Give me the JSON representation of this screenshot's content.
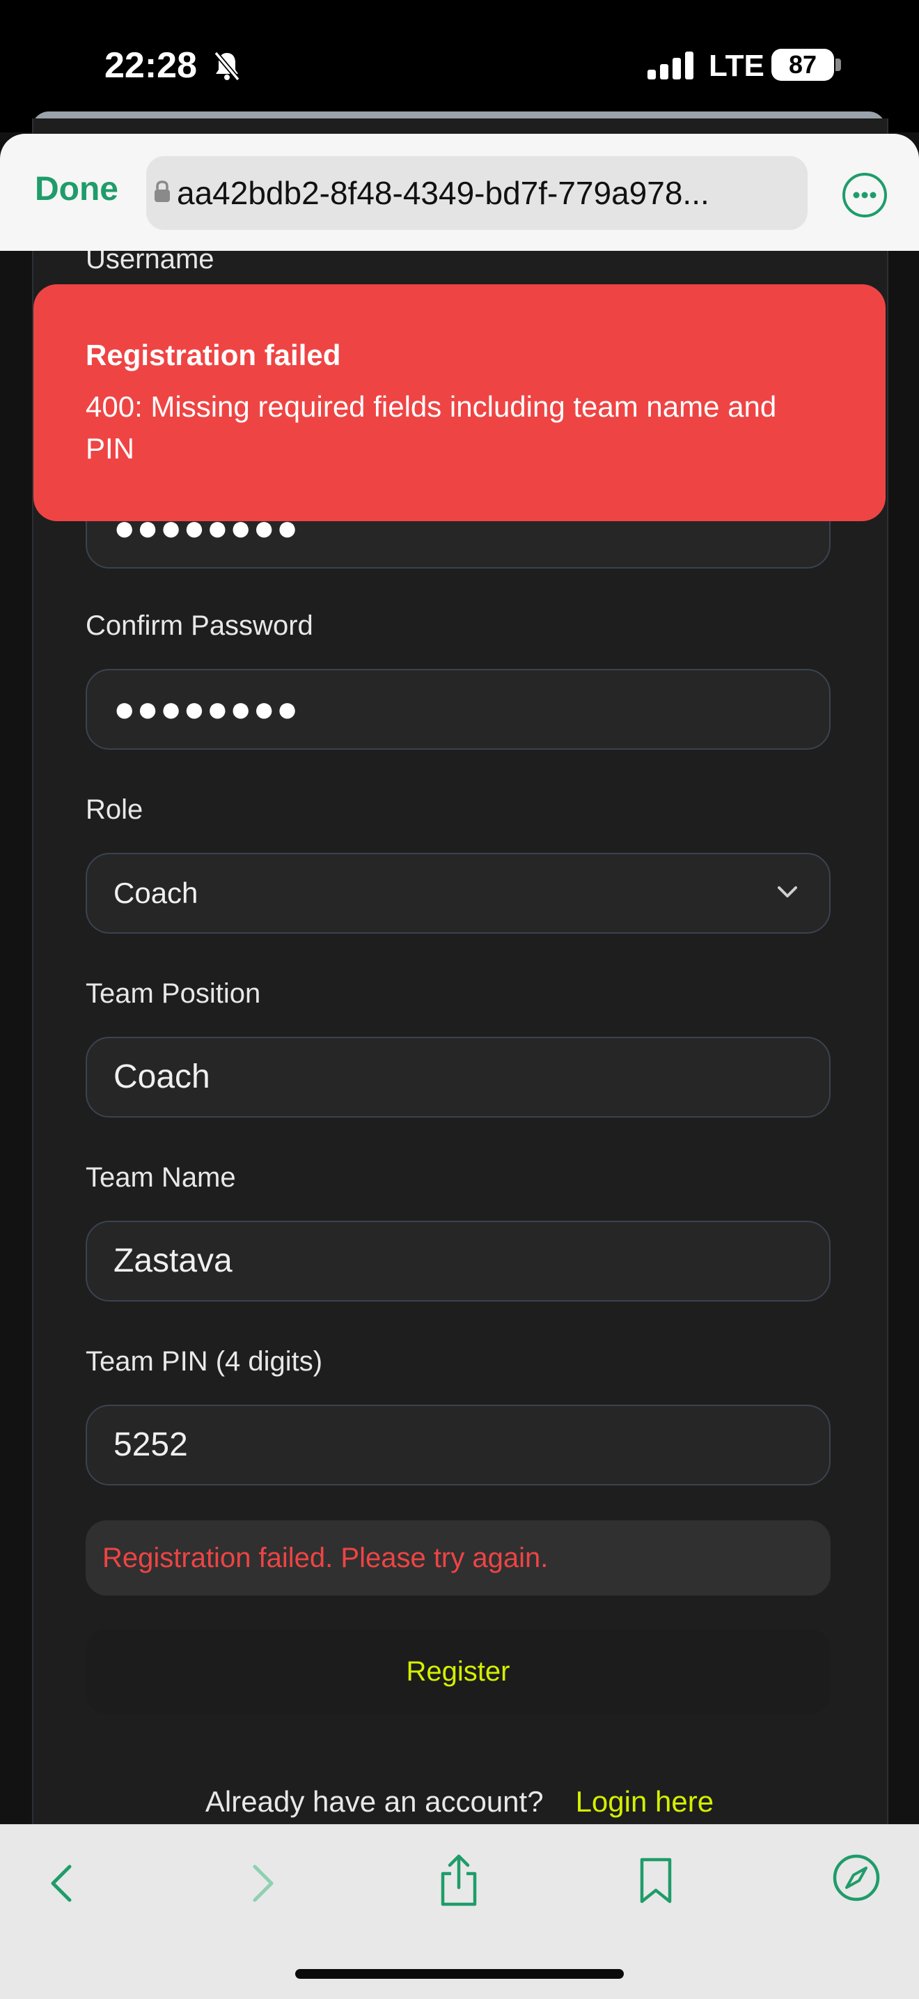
{
  "status_bar": {
    "time": "22:28",
    "network": "LTE",
    "battery": "87"
  },
  "browser": {
    "done_label": "Done",
    "url": "aa42bdb2-8f48-4349-bd7f-779a978..."
  },
  "toast": {
    "title": "Registration failed",
    "message": "400: Missing required fields including team name and PIN"
  },
  "form": {
    "username_label": "Username",
    "password_value": "●●●●●●●●",
    "confirm_password_label": "Confirm Password",
    "confirm_password_value": "●●●●●●●●",
    "role_label": "Role",
    "role_value": "Coach",
    "team_position_label": "Team Position",
    "team_position_value": "Coach",
    "team_name_label": "Team Name",
    "team_name_value": "Zastava",
    "team_pin_label": "Team PIN (4 digits)",
    "team_pin_value": "5252",
    "error_message": "Registration failed. Please try again.",
    "register_label": "Register",
    "login_prompt": "Already have an account?",
    "login_link": "Login here"
  },
  "colors": {
    "accent": "#d4f000",
    "error": "#ef4444",
    "browser_accent": "#1f9c6a"
  }
}
